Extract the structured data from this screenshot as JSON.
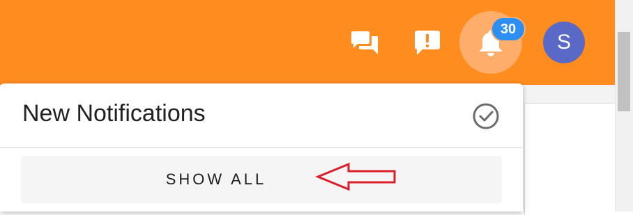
{
  "header": {
    "background_color": "#fe8c1f",
    "icons": {
      "chat": "chat-icon",
      "feedback": "feedback-icon",
      "notifications": "bell-icon"
    },
    "notification_badge": "30",
    "badge_color": "#2d8ff2",
    "avatar_initial": "S",
    "avatar_color": "#5b69c6"
  },
  "notifications_panel": {
    "title": "New Notifications",
    "mark_all_read_icon": "check-circle-icon",
    "show_all_label": "SHOW ALL",
    "annotation": "arrow-pointing-left",
    "annotation_color": "#d9202a"
  }
}
